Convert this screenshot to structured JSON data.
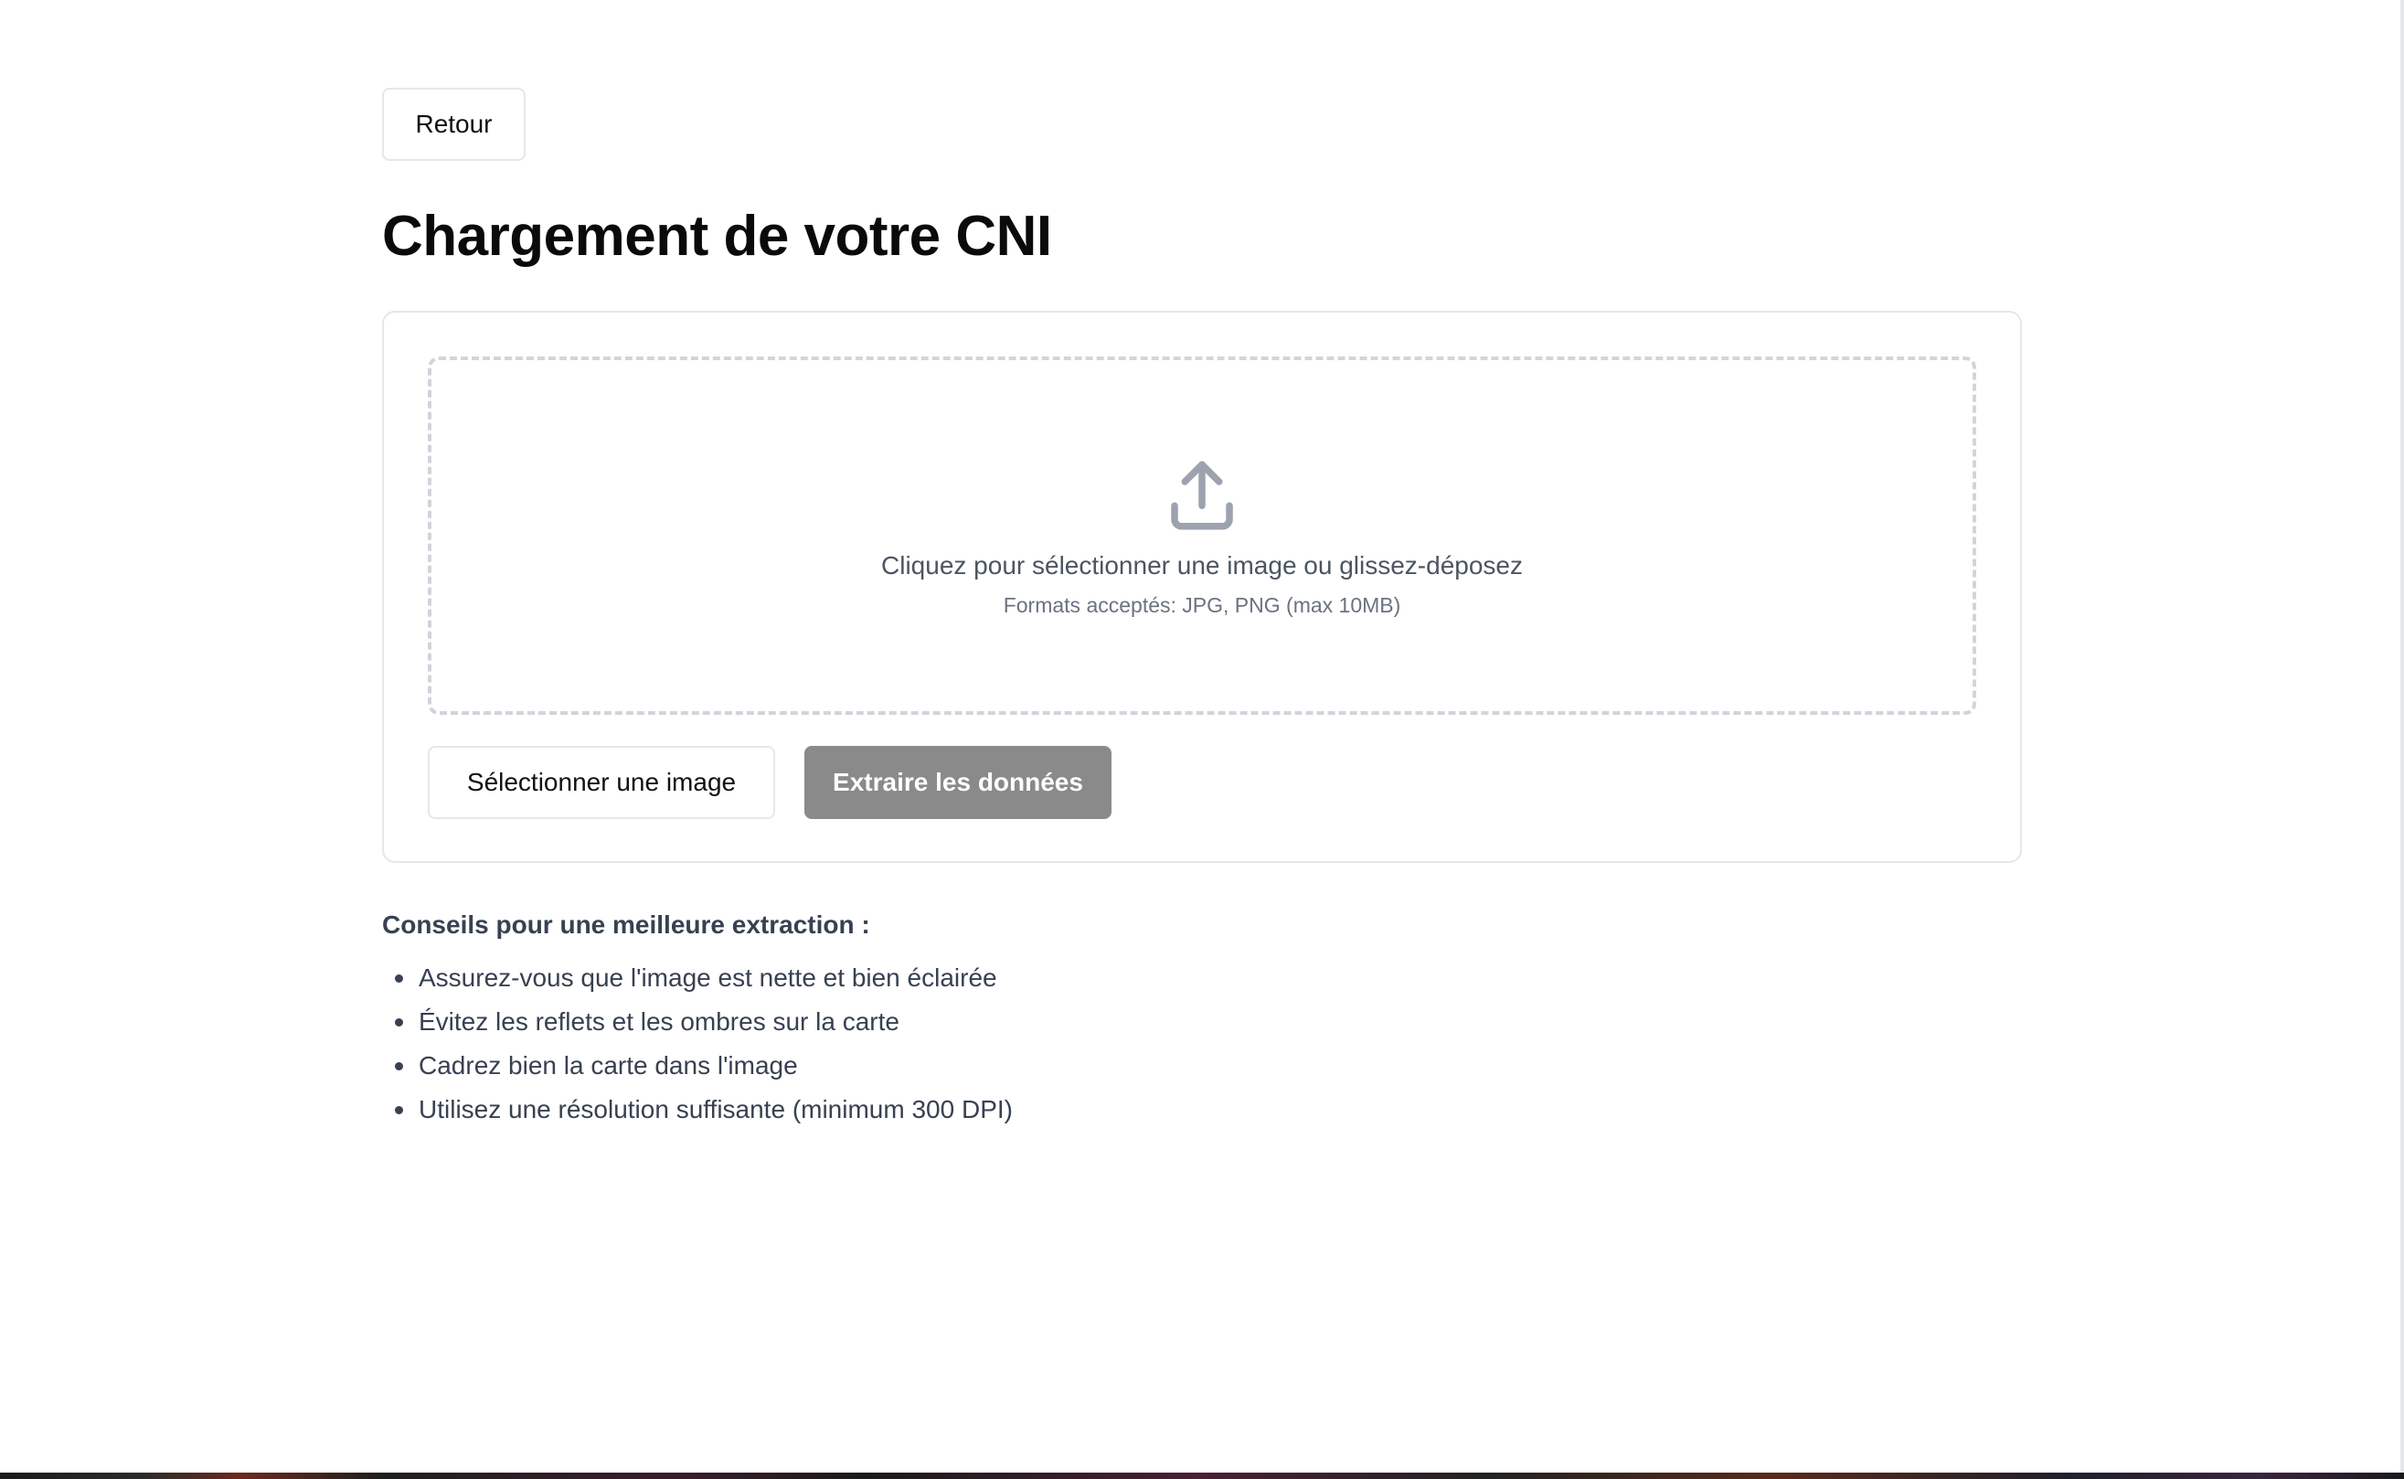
{
  "header": {
    "back_label": "Retour",
    "title": "Chargement de votre CNI"
  },
  "upload": {
    "icon": "upload-icon",
    "instruction": "Cliquez pour sélectionner une image ou glissez-déposez",
    "formats": "Formats acceptés: JPG, PNG (max 10MB)",
    "select_label": "Sélectionner une image",
    "extract_label": "Extraire les données"
  },
  "tips": {
    "title": "Conseils pour une meilleure extraction :",
    "items": [
      "Assurez-vous que l'image est nette et bien éclairée",
      "Évitez les reflets et les ombres sur la carte",
      "Cadrez bien la carte dans l'image",
      "Utilisez une résolution suffisante (minimum 300 DPI)"
    ]
  },
  "colors": {
    "primary_disabled": "#8a8a8a",
    "border": "#e5e7eb",
    "dropzone_border": "#d1d5db",
    "muted_text": "#4b5563"
  }
}
